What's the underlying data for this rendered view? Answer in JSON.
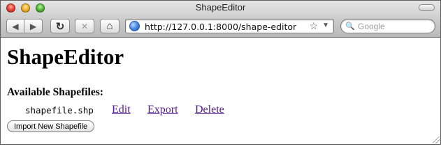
{
  "window": {
    "title": "ShapeEditor"
  },
  "toolbar": {
    "back_icon": "◀",
    "forward_icon": "▶",
    "reload_icon": "↻",
    "stop_icon": "✕",
    "home_icon": "⌂",
    "url": "http://127.0.0.1:8000/shape-editor",
    "bookmark_icon": "☆",
    "dropdown_icon": "▼",
    "search_icon": "🔍",
    "search_placeholder": "Google"
  },
  "page": {
    "title": "ShapeEditor",
    "section_heading": "Available Shapefiles:",
    "shapefiles": [
      {
        "name": "shapefile.shp",
        "edit_label": "Edit",
        "export_label": "Export",
        "delete_label": "Delete"
      }
    ],
    "import_button_label": "Import New Shapefile"
  },
  "colors": {
    "visited_link": "#551a8b",
    "chrome_top": "#e6e6e6",
    "chrome_bottom": "#b9b9b9"
  }
}
